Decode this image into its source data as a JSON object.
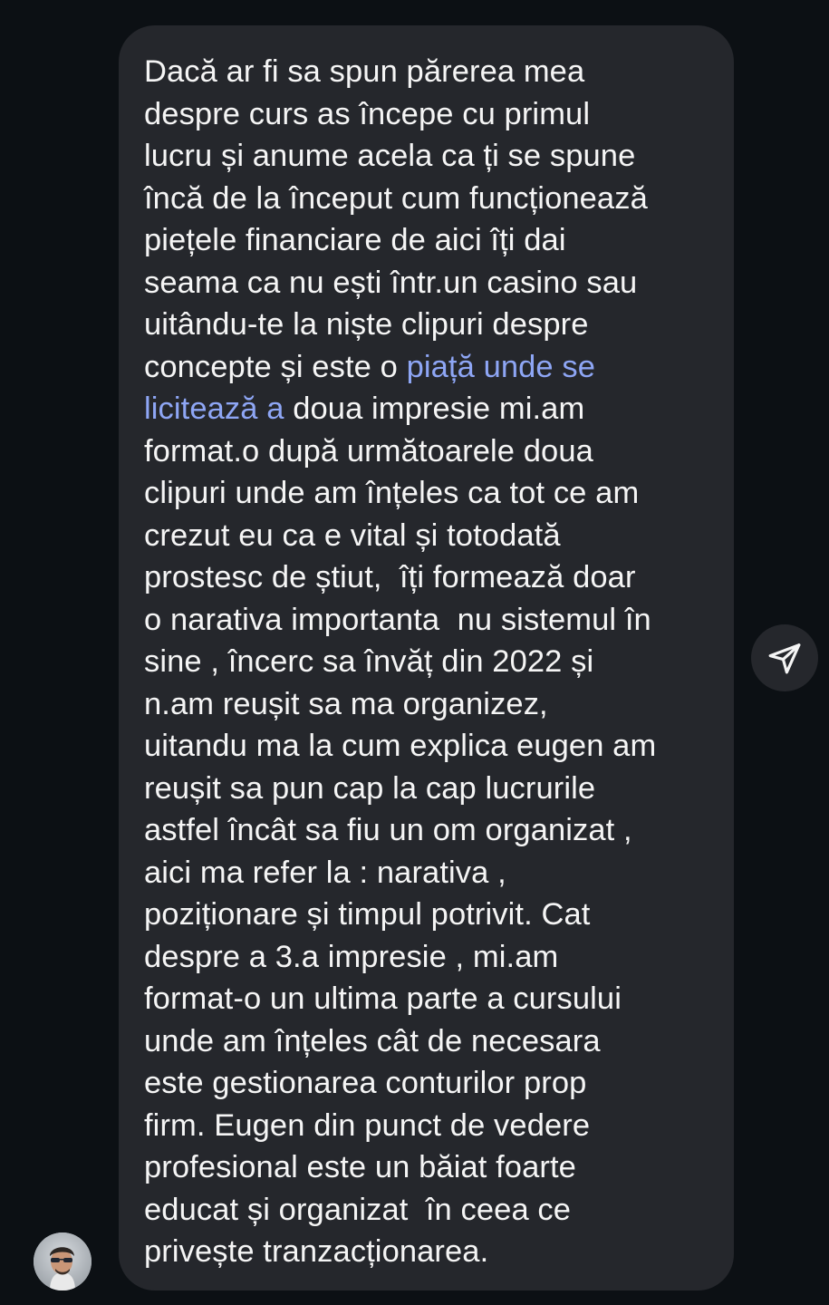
{
  "message": {
    "lines": [
      "Dacă ar fi sa spun părerea mea",
      "despre curs as începe cu primul",
      "lucru și anume acela ca ți se spune",
      "încă de la început cum funcționează",
      "piețele financiare de aici îți dai",
      "seama ca nu ești într.un casino sau",
      "uitându-te la niște clipuri despre",
      "concepte și este o "
    ],
    "link_inline_1": "piață unde se",
    "link_line_start": "licitează a",
    "after_link": " doua impresie mi.am",
    "lines_after": [
      "format.o după următoarele doua",
      "clipuri unde am înțeles ca tot ce am",
      "crezut eu ca e vital și totodată",
      "prostesc de știut,  îți formează doar",
      "o narativa importanta  nu sistemul în",
      "sine , încerc sa învăț din 2022 și",
      "n.am reușit sa ma organizez,",
      "uitandu ma la cum explica eugen am",
      "reușit sa pun cap la cap lucrurile",
      "astfel încât sa fiu un om organizat ,",
      "aici ma refer la : narativa ,",
      "poziționare și timpul potrivit. Cat",
      "despre a 3.a impresie , mi.am",
      "format-o un ultima parte a cursului",
      "unde am înțeles cât de necesara",
      "este gestionarea conturilor prop",
      "firm. Eugen din punct de vedere",
      "profesional este un băiat foarte",
      "educat și organizat  în ceea ce",
      "privește tranzacționarea."
    ],
    "colors": {
      "bubble": "#25272c",
      "text": "#f5f5f5",
      "link": "#8ea6f5",
      "background": "#0c1014"
    }
  },
  "icons": {
    "share": "paper-plane-icon",
    "avatar": "user-avatar"
  }
}
